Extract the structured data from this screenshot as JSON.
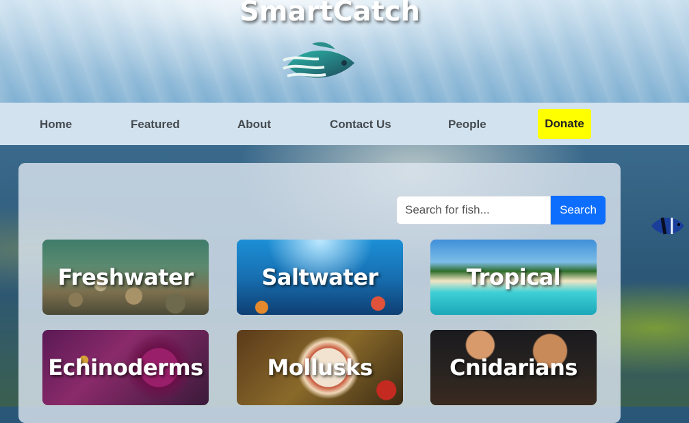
{
  "header": {
    "title": "SmartCatch",
    "logo_icon": "fish-logo-icon"
  },
  "nav": {
    "items": [
      {
        "label": "Home"
      },
      {
        "label": "Featured"
      },
      {
        "label": "About"
      },
      {
        "label": "Contact Us"
      },
      {
        "label": "People"
      }
    ],
    "donate_label": "Donate",
    "donate_color": "#ffff00"
  },
  "search": {
    "placeholder": "Search for fish...",
    "button_label": "Search",
    "button_color": "#0d6efd"
  },
  "categories": [
    {
      "label": "Freshwater"
    },
    {
      "label": "Saltwater"
    },
    {
      "label": "Tropical"
    },
    {
      "label": "Echinoderms"
    },
    {
      "label": "Mollusks"
    },
    {
      "label": "Cnidarians"
    }
  ]
}
